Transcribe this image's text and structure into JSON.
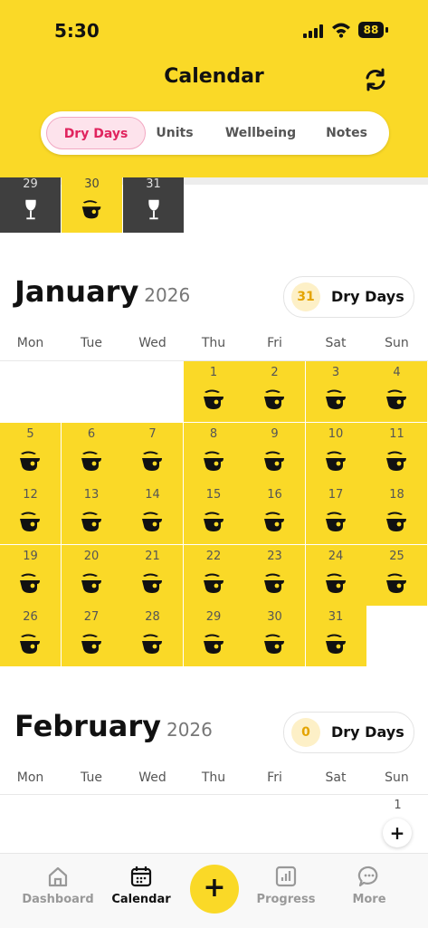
{
  "status_bar": {
    "time": "5:30",
    "battery": "88"
  },
  "header": {
    "title": "Calendar",
    "tabs": [
      {
        "label": "Dry Days",
        "active": true
      },
      {
        "label": "Units",
        "active": false
      },
      {
        "label": "Wellbeing",
        "active": false
      },
      {
        "label": "Notes",
        "active": false
      }
    ]
  },
  "previous_month_tail": [
    {
      "day": "29",
      "status": "drink"
    },
    {
      "day": "30",
      "status": "dry"
    },
    {
      "day": "31",
      "status": "drink"
    }
  ],
  "weekdays": [
    "Mon",
    "Tue",
    "Wed",
    "Thu",
    "Fri",
    "Sat",
    "Sun"
  ],
  "months": [
    {
      "name": "January",
      "year": "2026",
      "dry_days": "31",
      "dry_days_label": "Dry Days"
    },
    {
      "name": "February",
      "year": "2026",
      "dry_days": "0",
      "dry_days_label": "Dry Days"
    }
  ],
  "february_visible_day": "1",
  "colors": {
    "accent": "#FAD927",
    "active_tab": "#E0245E",
    "drink_day": "#3f3f3f"
  },
  "tabbar": {
    "items": [
      {
        "label": "Dashboard",
        "icon": "home-icon",
        "active": false
      },
      {
        "label": "Calendar",
        "icon": "calendar-icon",
        "active": true
      },
      {
        "label": "Progress",
        "icon": "bar-chart-icon",
        "active": false
      },
      {
        "label": "More",
        "icon": "chat-bubble-icon",
        "active": false
      }
    ],
    "add_label": "+"
  }
}
